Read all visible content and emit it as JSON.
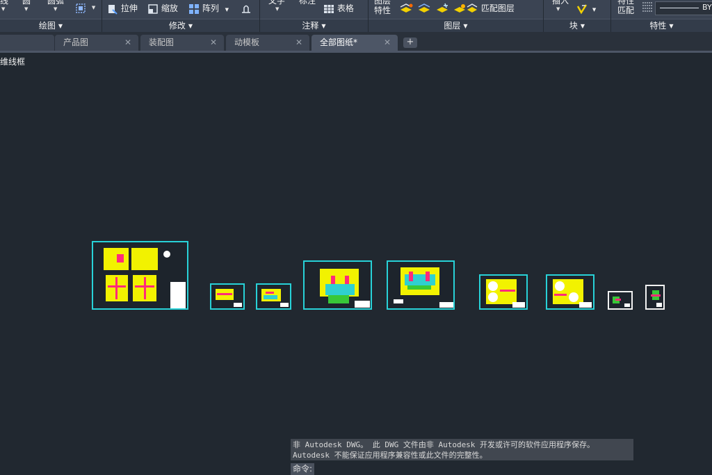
{
  "ribbon": {
    "panels": {
      "draw": "绘图",
      "modify": "修改",
      "annotate": "注释",
      "layers": "图层",
      "block": "块",
      "properties": "特性"
    },
    "cut_top": {
      "line": "线",
      "circle": "圆",
      "arc": "圆弧",
      "text": "文字",
      "dimension": "标注",
      "layer_props": "图层",
      "insert": "插入",
      "match_props": "特性"
    },
    "buttons": {
      "stretch": "拉伸",
      "scale": "缩放",
      "array": "阵列",
      "table": "表格",
      "layer_properties": "特性",
      "match_layer": "匹配图层",
      "match_properties": "匹配",
      "linetype_value": "BY"
    }
  },
  "tabs": [
    {
      "label": "产品图",
      "active": false
    },
    {
      "label": "装配图",
      "active": false
    },
    {
      "label": "动模板",
      "active": false
    },
    {
      "label": "全部图纸*",
      "active": true
    }
  ],
  "viewport_label": "二维线框",
  "command": {
    "message_line1": "非 Autodesk DWG。  此 DWG 文件由非 Autodesk 开发或许可的软件应用程序保存。",
    "message_line2": "Autodesk 不能保证应用程序兼容性或此文件的完整性。",
    "prompt": "命令:"
  },
  "colors": {
    "canvas": "#212830",
    "ribbon": "#3b4453",
    "sheet_border": "#28d2d8",
    "entity_yellow": "#f2f200",
    "entity_magenta": "#ff2a7a"
  }
}
